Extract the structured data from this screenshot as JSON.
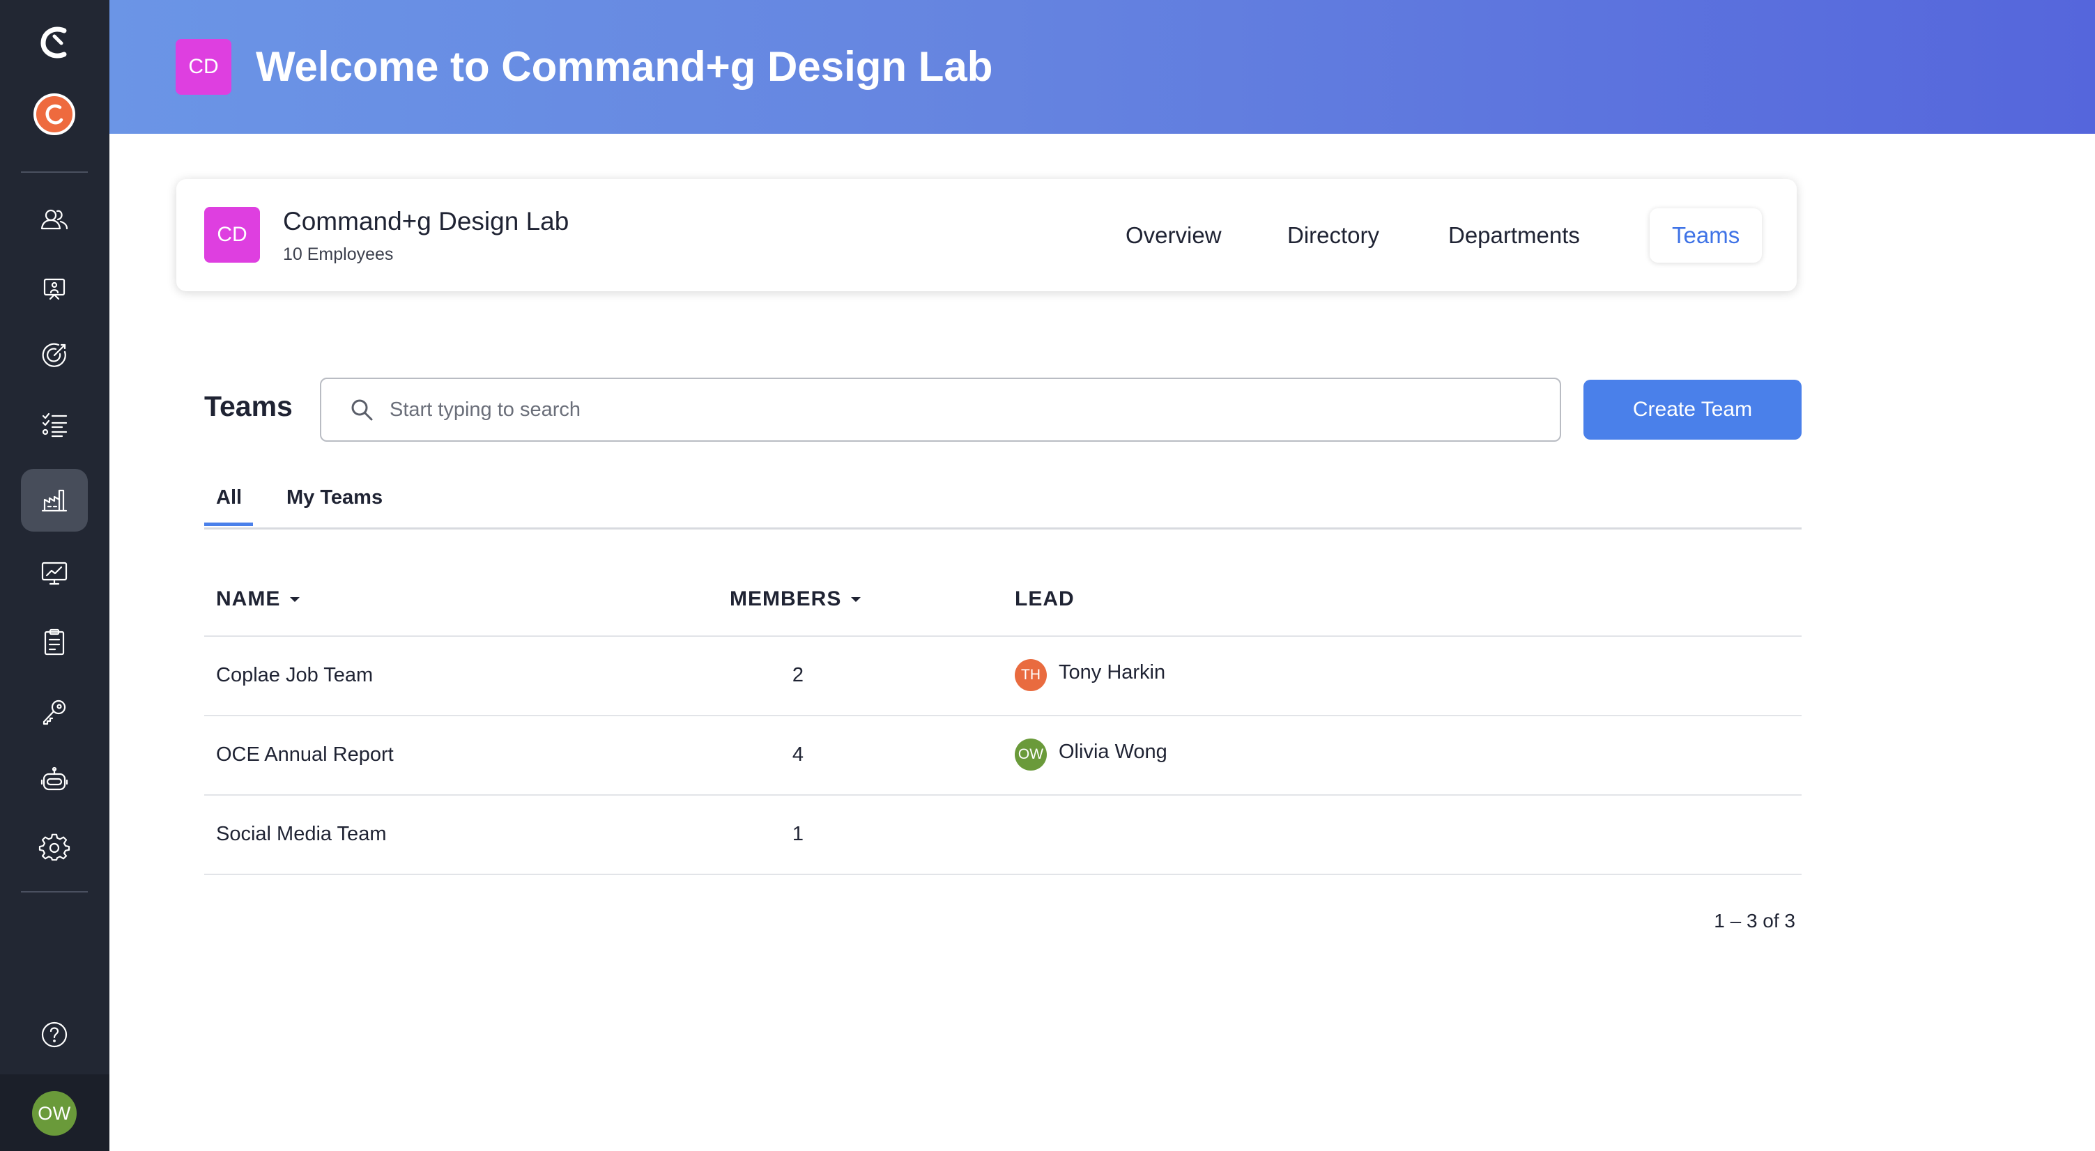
{
  "sidebar": {
    "items": [
      {
        "icon": "people-icon"
      },
      {
        "icon": "presentation-person-icon"
      },
      {
        "icon": "target-icon"
      },
      {
        "icon": "checklist-icon"
      },
      {
        "icon": "organization-chart-icon",
        "active": true
      },
      {
        "icon": "monitor-chart-icon"
      },
      {
        "icon": "clipboard-icon"
      },
      {
        "icon": "key-icon"
      },
      {
        "icon": "robot-icon"
      },
      {
        "icon": "gear-icon"
      }
    ],
    "help_icon": "help-icon",
    "user_avatar_initials": "OW",
    "user_avatar_color": "#6a9a3a",
    "company_icon_color": "#ee6a3e"
  },
  "header": {
    "badge_initials": "CD",
    "badge_color": "#de3fe0",
    "title": "Welcome to Command+g Design Lab"
  },
  "company_card": {
    "badge_initials": "CD",
    "name": "Command+g Design Lab",
    "employees": "10 Employees",
    "nav": [
      {
        "label": "Overview"
      },
      {
        "label": "Directory"
      },
      {
        "label": "Departments"
      },
      {
        "label": "Teams",
        "active": true
      }
    ]
  },
  "teams": {
    "title": "Teams",
    "search": {
      "placeholder": "Start typing to search",
      "value": ""
    },
    "create_label": "Create Team",
    "accent_color": "#4a80ea",
    "tabs": [
      {
        "label": "All",
        "active": true
      },
      {
        "label": "My Teams"
      }
    ],
    "columns": {
      "name": "NAME",
      "members": "MEMBERS",
      "lead": "LEAD"
    },
    "rows": [
      {
        "name": "Coplae Job Team",
        "members": "2",
        "lead": {
          "initials": "TH",
          "name": "Tony Harkin",
          "color": "#e96b3f"
        }
      },
      {
        "name": "OCE Annual Report",
        "members": "4",
        "lead": {
          "initials": "OW",
          "name": "Olivia Wong",
          "color": "#6a9a3a"
        }
      },
      {
        "name": "Social Media Team",
        "members": "1"
      }
    ],
    "pagination": "1 – 3 of 3"
  }
}
